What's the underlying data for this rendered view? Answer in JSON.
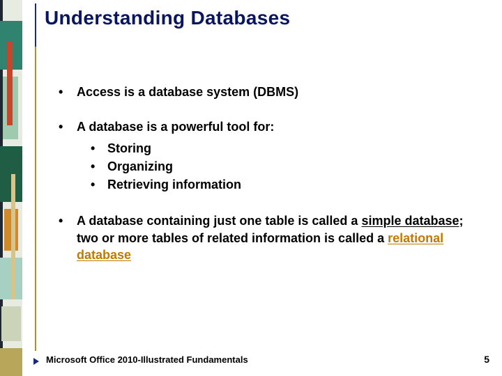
{
  "title": "Understanding Databases",
  "bullets": {
    "b1": {
      "text": "Access is a database system (DBMS)"
    },
    "b2": {
      "text": "A database is a powerful tool for:",
      "sub": [
        "Storing",
        "Organizing",
        "Retrieving information"
      ]
    },
    "b3": {
      "pre": "A database containing just one table is called a ",
      "term1": "simple database",
      "mid": "; two or more tables of related information is called a ",
      "term2": "relational database"
    }
  },
  "footer": "Microsoft Office 2010-Illustrated Fundamentals",
  "page_number": "5",
  "colors": {
    "title": "#0a1560",
    "rule_top": "#1a2a7a",
    "rule_bottom": "#b58d20",
    "relational": "#c07a00"
  }
}
